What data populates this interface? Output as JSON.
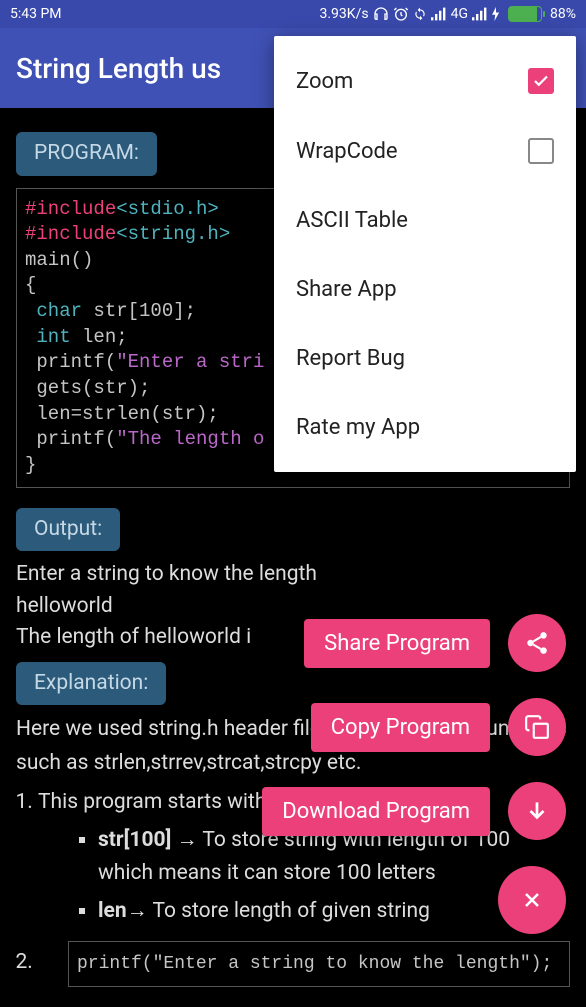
{
  "status": {
    "time": "5:43 PM",
    "speed": "3.93K/s",
    "network": "4G",
    "battery_pct": "88%"
  },
  "app_title": "String Length us",
  "sections": {
    "program_label": "PROGRAM:",
    "output_label": "Output:",
    "explanation_label": "Explanation:"
  },
  "code": {
    "inc1_a": "#include",
    "inc1_b": "<stdio.h>",
    "inc2_a": "#include",
    "inc2_b": "<string.h>",
    "l3": "main()",
    "l4": "{",
    "l5a": " char",
    "l5b": " str[100];",
    "l6a": " int",
    "l6b": " len;",
    "l7a": " printf(",
    "l7b": "\"Enter a stri",
    "l8": " gets(str);",
    "l9": " len=strlen(str);",
    "l10a": " printf(",
    "l10b": "\"The length o",
    "l11": "}"
  },
  "output": {
    "l1": "Enter a string to know the length",
    "l2": "helloworld",
    "l3": "The length of helloworld i"
  },
  "explanation": {
    "intro": "Here we used string.h header file for string library functions such as strlen,strrev,strcat,strcpy etc.",
    "li1": "This program starts with initializing :",
    "sub1_a": "str[100]",
    "sub1_b": " → To store string with length of 100 which means it can store 100 letters",
    "sub2_a": "len",
    "sub2_b": "→ To store length of given string",
    "bottom_code": "printf(\"Enter a string to know the length\");"
  },
  "menu": {
    "zoom": "Zoom",
    "wrap": "WrapCode",
    "ascii": "ASCII Table",
    "share": "Share App",
    "report": "Report Bug",
    "rate": "Rate my App"
  },
  "fab": {
    "share": "Share Program",
    "copy": "Copy Program",
    "download": "Download Program"
  }
}
